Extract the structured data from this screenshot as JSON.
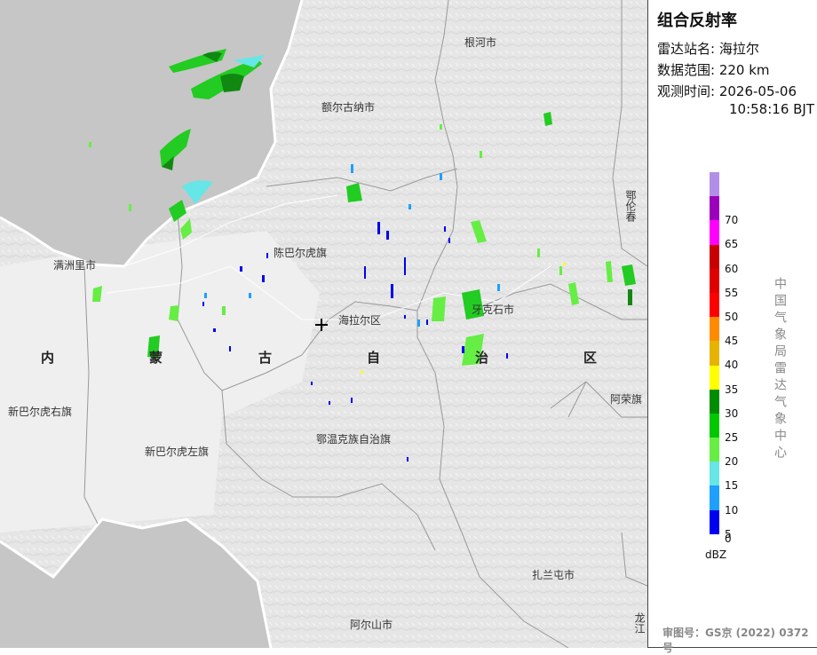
{
  "panel": {
    "title": "组合反射率",
    "station_label": "雷达站名:",
    "station_value": "海拉尔",
    "range_label": "数据范围:",
    "range_value": "220 km",
    "time_label": "观测时间:",
    "time_date": "2026-05-06",
    "time_clock": "10:58:16 BJT",
    "unit": "dBZ",
    "vendor": "中国气象局雷达气象中心",
    "approval": "审图号：GS京 (2022) 0372号"
  },
  "legend": {
    "levels": [
      {
        "label": "",
        "color": "#b38ee8"
      },
      {
        "label": "70",
        "color": "#9b00bb"
      },
      {
        "label": "65",
        "color": "#ff00ff"
      },
      {
        "label": "60",
        "color": "#c80000"
      },
      {
        "label": "55",
        "color": "#e00000"
      },
      {
        "label": "50",
        "color": "#ff0000"
      },
      {
        "label": "45",
        "color": "#ff8c00"
      },
      {
        "label": "40",
        "color": "#e6b400"
      },
      {
        "label": "35",
        "color": "#ffff00"
      },
      {
        "label": "30",
        "color": "#008c00"
      },
      {
        "label": "25",
        "color": "#00c800"
      },
      {
        "label": "20",
        "color": "#66ee44"
      },
      {
        "label": "15",
        "color": "#66e6e6"
      },
      {
        "label": "10",
        "color": "#1ea0ff"
      },
      {
        "label": "5",
        "color": "#0000f0"
      },
      {
        "label": "0",
        "color": ""
      }
    ]
  },
  "map": {
    "cities": [
      "根河市",
      "额尔古纳市",
      "陈巴尔虎旗",
      "满洲里市",
      "海拉尔区",
      "牙克石市",
      "新巴尔虎右旗",
      "新巴尔虎左旗",
      "鄂温克族自治旗",
      "扎兰屯市",
      "阿尔山市",
      "阿荣旗"
    ],
    "region_chars": [
      "内",
      "蒙",
      "古",
      "自",
      "治",
      "区"
    ],
    "edge_labels": [
      "鄂伦春",
      "龙江"
    ]
  },
  "colors": {
    "land": "#e9e9e9",
    "neighbor": "#c6c6c6",
    "water": "#b9b9b9",
    "border": "#ffffff"
  }
}
